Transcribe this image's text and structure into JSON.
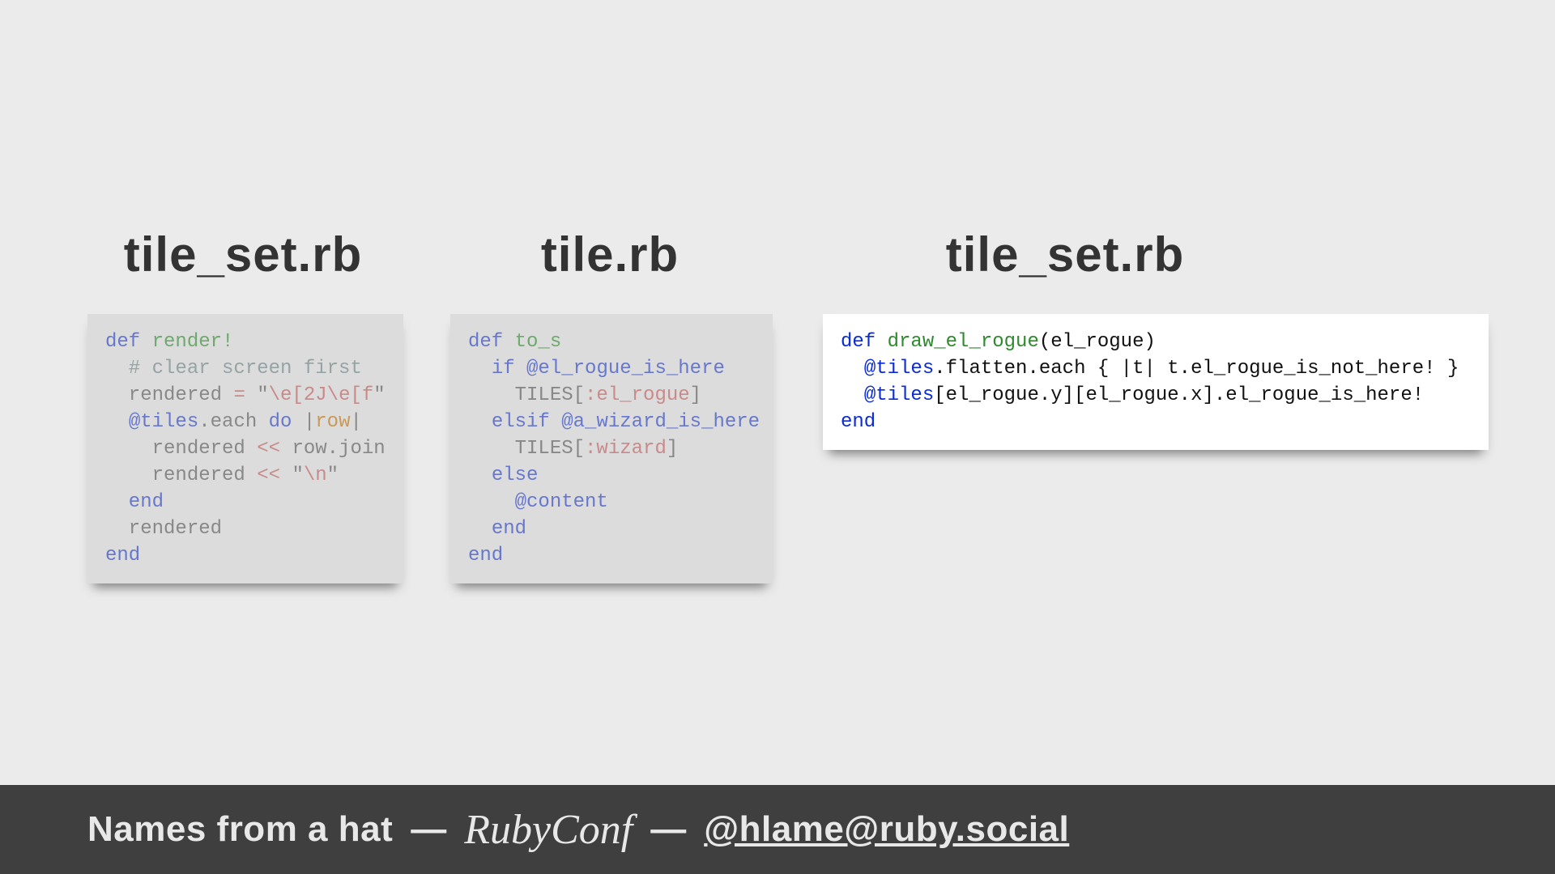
{
  "titles": {
    "t1": "tile_set.rb",
    "t2": "tile.rb",
    "t3": "tile_set.rb"
  },
  "code1": {
    "l1_def": "def",
    "l1_name": " render!",
    "l2_com": "  # clear screen first",
    "l3_a": "  rendered ",
    "l3_eq": "=",
    "l3_b": " ",
    "l3_q1": "\"",
    "l3_str": "\\e[2J\\e[f",
    "l3_q2": "\"",
    "l4_a": "  ",
    "l4_ivar": "@tiles",
    "l4_b": ".each ",
    "l4_do": "do",
    "l4_c": " ",
    "l4_p1": "|",
    "l4_row": "row",
    "l4_p2": "|",
    "l5_a": "    rendered ",
    "l5_op": "<<",
    "l5_b": " row.join",
    "l6_a": "    rendered ",
    "l6_op": "<<",
    "l6_b": " ",
    "l6_q1": "\"",
    "l6_str": "\\n",
    "l6_q2": "\"",
    "l7_end": "  end",
    "l8": "  rendered",
    "l9_end": "end"
  },
  "code2": {
    "l1_def": "def",
    "l1_name": " to_s",
    "l2_a": "  ",
    "l2_if": "if",
    "l2_b": " ",
    "l2_ivar": "@el_rogue_is_here",
    "l3_a": "    TILES[",
    "l3_sym": ":el_rogue",
    "l3_b": "]",
    "l4_a": "  ",
    "l4_elsif": "elsif",
    "l4_b": " ",
    "l4_ivar": "@a_wizard_is_here",
    "l5_a": "    TILES[",
    "l5_sym": ":wizard",
    "l5_b": "]",
    "l6_a": "  ",
    "l6_else": "else",
    "l7_a": "    ",
    "l7_ivar": "@content",
    "l8_a": "  ",
    "l8_end": "end",
    "l9_end": "end"
  },
  "code3": {
    "l1_def": "def",
    "l1_name": " draw_el_rogue",
    "l1_rest": "(el_rogue)",
    "l2_a": "  ",
    "l2_ivar": "@tiles",
    "l2_b": ".flatten.each { |t| t.el_rogue_is_not_here! }",
    "l3_a": "  ",
    "l3_ivar": "@tiles",
    "l3_b": "[el_rogue.y][el_rogue.x].el_rogue_is_here!",
    "l4_end": "end"
  },
  "footer": {
    "names": "Names from a hat",
    "dash": "—",
    "conf": "RubyConf",
    "handle": "@hlame@ruby.social"
  }
}
